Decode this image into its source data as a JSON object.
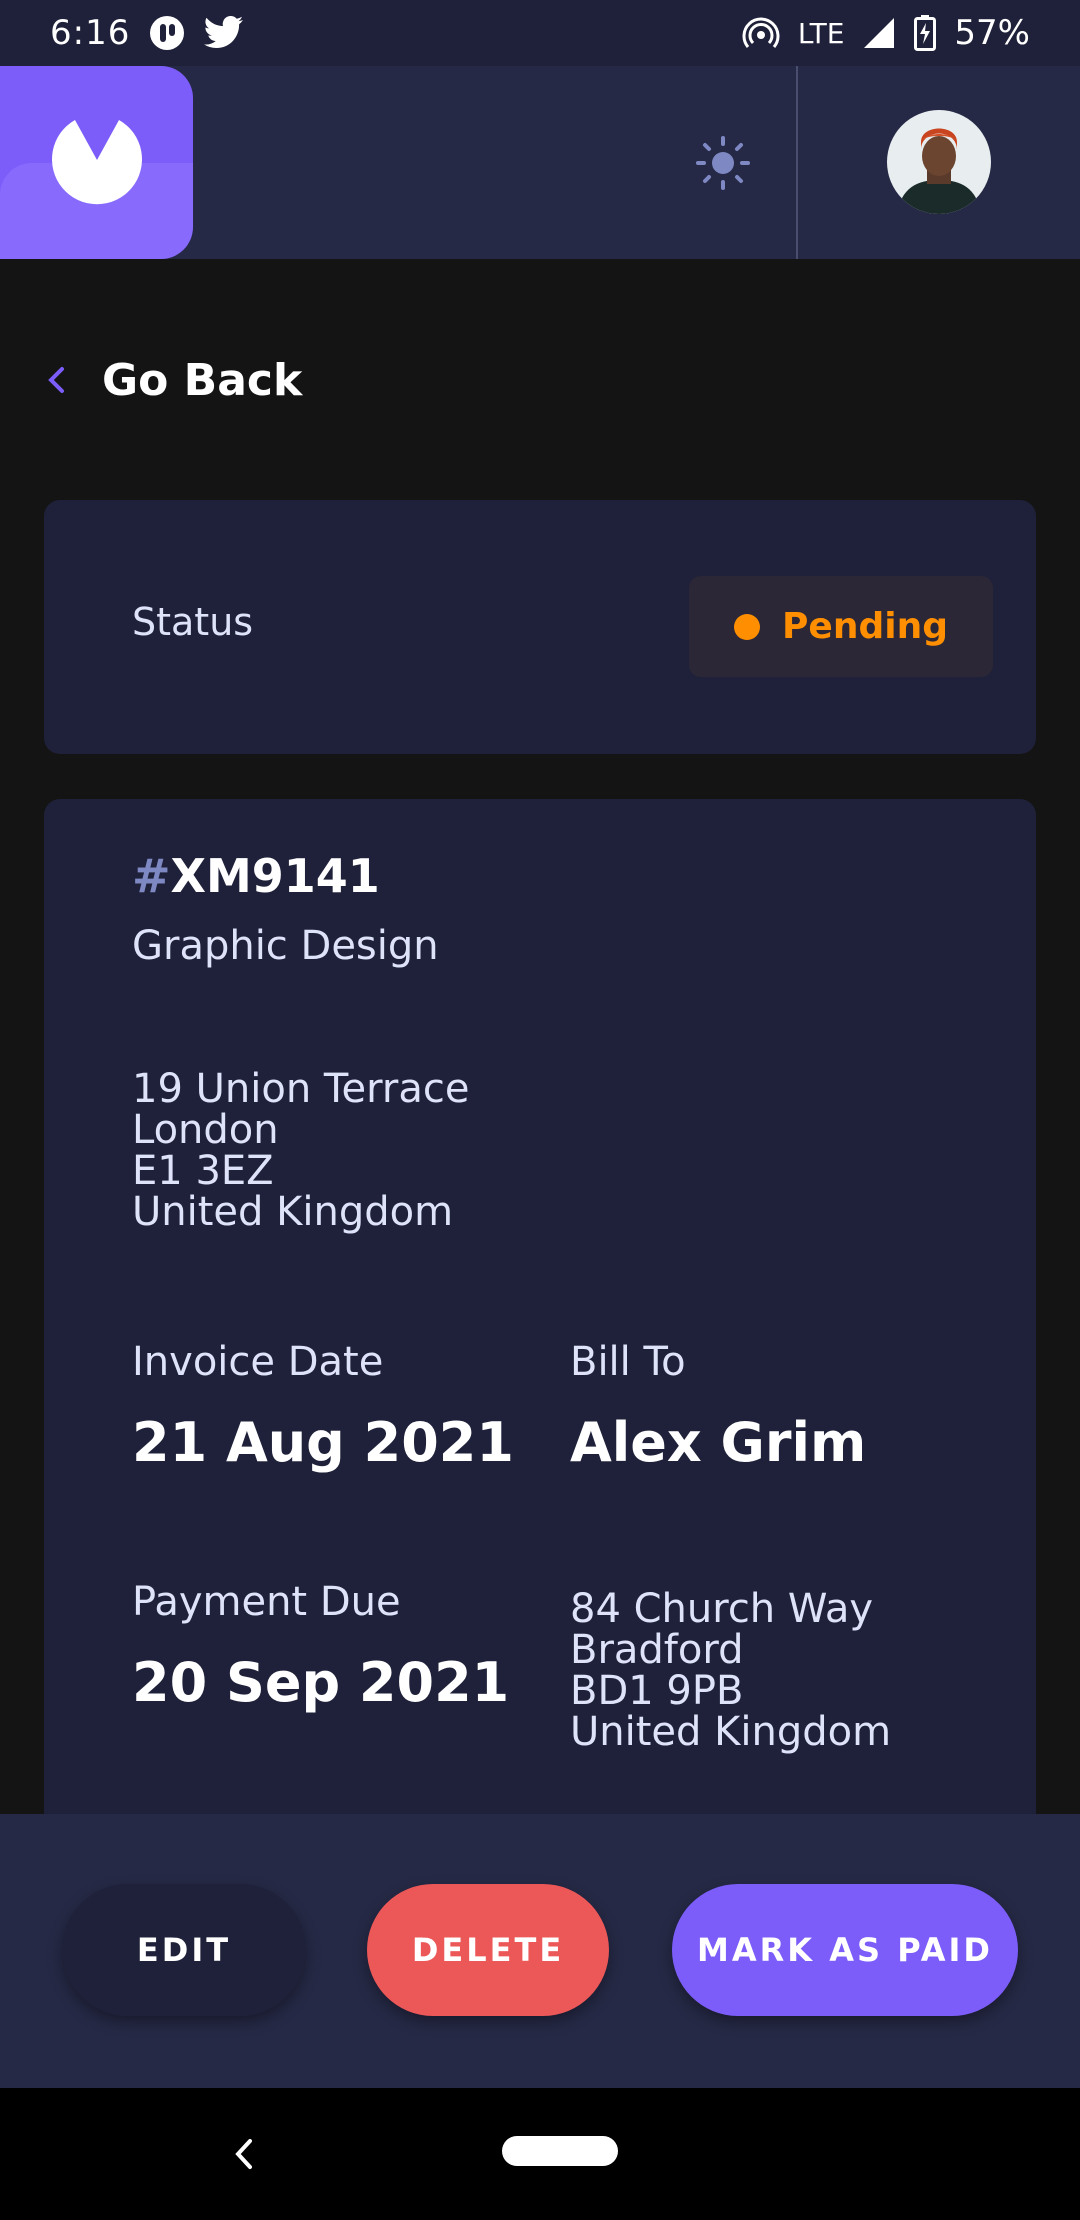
{
  "status_bar": {
    "time": "6:16",
    "network": "LTE",
    "battery": "57%"
  },
  "header": {
    "logo_icon": "app-logo",
    "theme_icon": "sun-icon",
    "avatar_icon": "user-avatar"
  },
  "nav": {
    "go_back_label": "Go Back"
  },
  "status_card": {
    "label": "Status",
    "status": "Pending",
    "status_color": "#ff8f00"
  },
  "invoice": {
    "id_hash": "#",
    "id": "XM9141",
    "description": "Graphic Design",
    "sender_address": {
      "street": "19 Union Terrace",
      "city": "London",
      "post_code": "E1 3EZ",
      "country": "United Kingdom"
    },
    "invoice_date_label": "Invoice Date",
    "invoice_date": "21 Aug 2021",
    "payment_due_label": "Payment Due",
    "payment_due": "20 Sep 2021",
    "bill_to_label": "Bill To",
    "client_name": "Alex Grim",
    "client_address": {
      "street": "84 Church Way",
      "city": "Bradford",
      "post_code": "BD1 9PB",
      "country": "United Kingdom"
    }
  },
  "actions": {
    "edit_label": "EDIT",
    "delete_label": "DELETE",
    "mark_paid_label": "MARK AS PAID"
  },
  "colors": {
    "accent": "#7c5dfa",
    "danger": "#ec5757",
    "card": "#1e2139",
    "header": "#252945"
  }
}
